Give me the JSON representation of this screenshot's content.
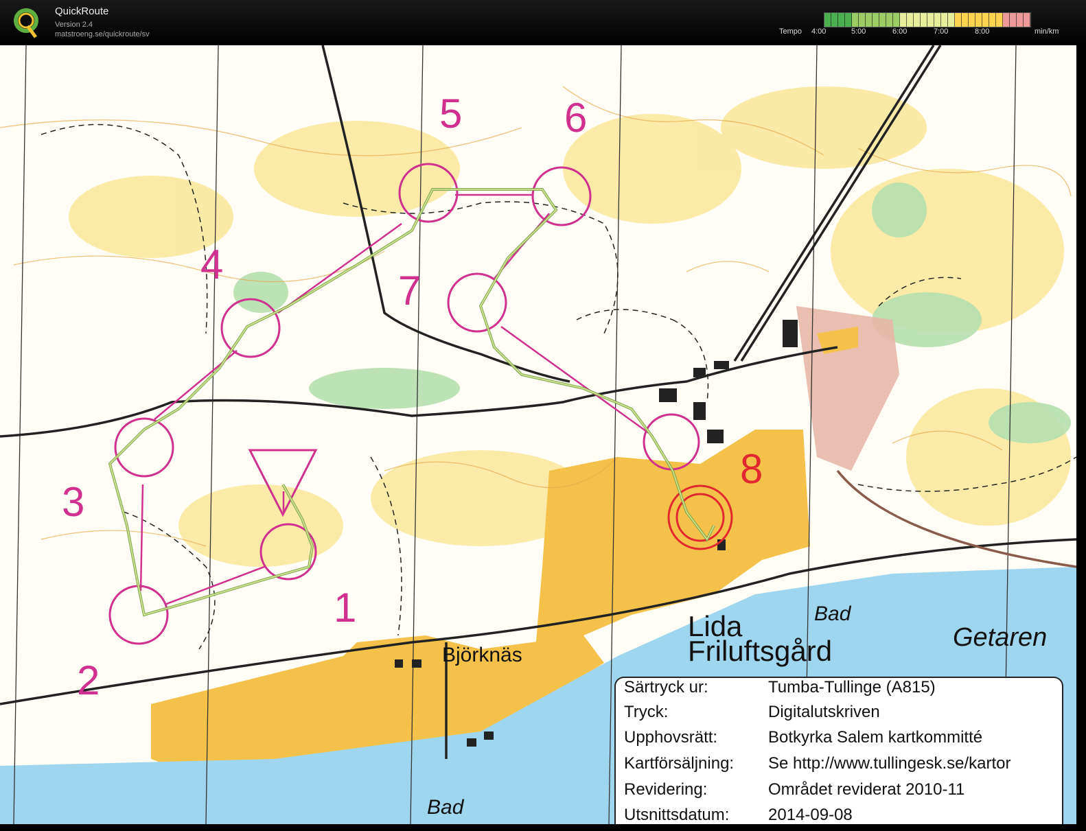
{
  "app": {
    "title": "QuickRoute",
    "version": "Version 2.4",
    "url": "matstroeng.se/quickroute/sv"
  },
  "pace_legend": {
    "label": "Tempo",
    "ticks": [
      "4:00",
      "5:00",
      "6:00",
      "7:00",
      "8:00"
    ],
    "unit": "min/km",
    "colors": [
      "#4caf50",
      "#9ccc65",
      "#e6ee9c",
      "#ffd54f",
      "#ef9a9a"
    ]
  },
  "map": {
    "control_numbers": [
      "1",
      "2",
      "3",
      "4",
      "5",
      "6",
      "7",
      "8"
    ],
    "place_names": {
      "lida": "Lida",
      "friluftsgard": "Friluftsgård",
      "bjorknas": "Björknäs",
      "getaren": "Getaren",
      "bad_top": "Bad",
      "bad_bottom": "Bad"
    },
    "colors": {
      "course": "#d0308e",
      "finish": "#e0282e",
      "route": "#7aa64a",
      "water": "#9fd6ef",
      "open_land": "#f4c24a",
      "rough_open": "#fbe79a",
      "vegetation": "#b5dfae"
    }
  },
  "info": {
    "rows": [
      {
        "label": "Särtryck ur:",
        "value": "Tumba-Tullinge (A815)"
      },
      {
        "label": "Tryck:",
        "value": "Digitalutskriven"
      },
      {
        "label": "Upphovsrätt:",
        "value": "Botkyrka Salem kartkommitté"
      },
      {
        "label": "Kartförsäljning:",
        "value": "Se http://www.tullingesk.se/kartor"
      },
      {
        "label": "Revidering:",
        "value": "Området reviderat 2010-11"
      },
      {
        "label": "Utsnittsdatum:",
        "value": "2014-09-08"
      }
    ]
  }
}
